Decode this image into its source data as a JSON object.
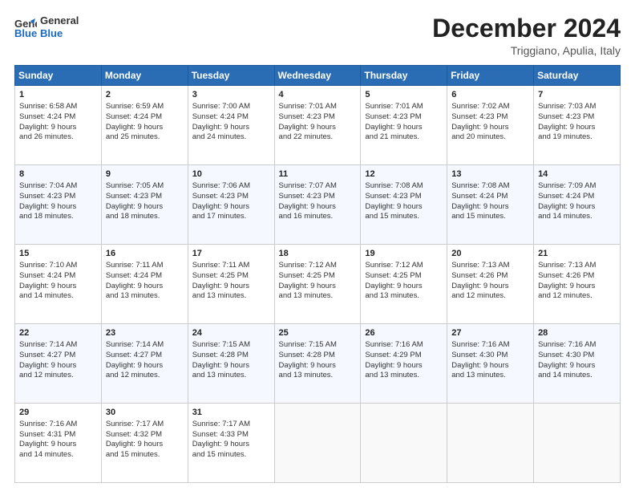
{
  "logo": {
    "line1": "General",
    "line2": "Blue"
  },
  "title": "December 2024",
  "location": "Triggiano, Apulia, Italy",
  "weekdays": [
    "Sunday",
    "Monday",
    "Tuesday",
    "Wednesday",
    "Thursday",
    "Friday",
    "Saturday"
  ],
  "weeks": [
    [
      {
        "day": "1",
        "lines": [
          "Sunrise: 6:58 AM",
          "Sunset: 4:24 PM",
          "Daylight: 9 hours",
          "and 26 minutes."
        ]
      },
      {
        "day": "2",
        "lines": [
          "Sunrise: 6:59 AM",
          "Sunset: 4:24 PM",
          "Daylight: 9 hours",
          "and 25 minutes."
        ]
      },
      {
        "day": "3",
        "lines": [
          "Sunrise: 7:00 AM",
          "Sunset: 4:24 PM",
          "Daylight: 9 hours",
          "and 24 minutes."
        ]
      },
      {
        "day": "4",
        "lines": [
          "Sunrise: 7:01 AM",
          "Sunset: 4:23 PM",
          "Daylight: 9 hours",
          "and 22 minutes."
        ]
      },
      {
        "day": "5",
        "lines": [
          "Sunrise: 7:01 AM",
          "Sunset: 4:23 PM",
          "Daylight: 9 hours",
          "and 21 minutes."
        ]
      },
      {
        "day": "6",
        "lines": [
          "Sunrise: 7:02 AM",
          "Sunset: 4:23 PM",
          "Daylight: 9 hours",
          "and 20 minutes."
        ]
      },
      {
        "day": "7",
        "lines": [
          "Sunrise: 7:03 AM",
          "Sunset: 4:23 PM",
          "Daylight: 9 hours",
          "and 19 minutes."
        ]
      }
    ],
    [
      {
        "day": "8",
        "lines": [
          "Sunrise: 7:04 AM",
          "Sunset: 4:23 PM",
          "Daylight: 9 hours",
          "and 18 minutes."
        ]
      },
      {
        "day": "9",
        "lines": [
          "Sunrise: 7:05 AM",
          "Sunset: 4:23 PM",
          "Daylight: 9 hours",
          "and 18 minutes."
        ]
      },
      {
        "day": "10",
        "lines": [
          "Sunrise: 7:06 AM",
          "Sunset: 4:23 PM",
          "Daylight: 9 hours",
          "and 17 minutes."
        ]
      },
      {
        "day": "11",
        "lines": [
          "Sunrise: 7:07 AM",
          "Sunset: 4:23 PM",
          "Daylight: 9 hours",
          "and 16 minutes."
        ]
      },
      {
        "day": "12",
        "lines": [
          "Sunrise: 7:08 AM",
          "Sunset: 4:23 PM",
          "Daylight: 9 hours",
          "and 15 minutes."
        ]
      },
      {
        "day": "13",
        "lines": [
          "Sunrise: 7:08 AM",
          "Sunset: 4:24 PM",
          "Daylight: 9 hours",
          "and 15 minutes."
        ]
      },
      {
        "day": "14",
        "lines": [
          "Sunrise: 7:09 AM",
          "Sunset: 4:24 PM",
          "Daylight: 9 hours",
          "and 14 minutes."
        ]
      }
    ],
    [
      {
        "day": "15",
        "lines": [
          "Sunrise: 7:10 AM",
          "Sunset: 4:24 PM",
          "Daylight: 9 hours",
          "and 14 minutes."
        ]
      },
      {
        "day": "16",
        "lines": [
          "Sunrise: 7:11 AM",
          "Sunset: 4:24 PM",
          "Daylight: 9 hours",
          "and 13 minutes."
        ]
      },
      {
        "day": "17",
        "lines": [
          "Sunrise: 7:11 AM",
          "Sunset: 4:25 PM",
          "Daylight: 9 hours",
          "and 13 minutes."
        ]
      },
      {
        "day": "18",
        "lines": [
          "Sunrise: 7:12 AM",
          "Sunset: 4:25 PM",
          "Daylight: 9 hours",
          "and 13 minutes."
        ]
      },
      {
        "day": "19",
        "lines": [
          "Sunrise: 7:12 AM",
          "Sunset: 4:25 PM",
          "Daylight: 9 hours",
          "and 13 minutes."
        ]
      },
      {
        "day": "20",
        "lines": [
          "Sunrise: 7:13 AM",
          "Sunset: 4:26 PM",
          "Daylight: 9 hours",
          "and 12 minutes."
        ]
      },
      {
        "day": "21",
        "lines": [
          "Sunrise: 7:13 AM",
          "Sunset: 4:26 PM",
          "Daylight: 9 hours",
          "and 12 minutes."
        ]
      }
    ],
    [
      {
        "day": "22",
        "lines": [
          "Sunrise: 7:14 AM",
          "Sunset: 4:27 PM",
          "Daylight: 9 hours",
          "and 12 minutes."
        ]
      },
      {
        "day": "23",
        "lines": [
          "Sunrise: 7:14 AM",
          "Sunset: 4:27 PM",
          "Daylight: 9 hours",
          "and 12 minutes."
        ]
      },
      {
        "day": "24",
        "lines": [
          "Sunrise: 7:15 AM",
          "Sunset: 4:28 PM",
          "Daylight: 9 hours",
          "and 13 minutes."
        ]
      },
      {
        "day": "25",
        "lines": [
          "Sunrise: 7:15 AM",
          "Sunset: 4:28 PM",
          "Daylight: 9 hours",
          "and 13 minutes."
        ]
      },
      {
        "day": "26",
        "lines": [
          "Sunrise: 7:16 AM",
          "Sunset: 4:29 PM",
          "Daylight: 9 hours",
          "and 13 minutes."
        ]
      },
      {
        "day": "27",
        "lines": [
          "Sunrise: 7:16 AM",
          "Sunset: 4:30 PM",
          "Daylight: 9 hours",
          "and 13 minutes."
        ]
      },
      {
        "day": "28",
        "lines": [
          "Sunrise: 7:16 AM",
          "Sunset: 4:30 PM",
          "Daylight: 9 hours",
          "and 14 minutes."
        ]
      }
    ],
    [
      {
        "day": "29",
        "lines": [
          "Sunrise: 7:16 AM",
          "Sunset: 4:31 PM",
          "Daylight: 9 hours",
          "and 14 minutes."
        ]
      },
      {
        "day": "30",
        "lines": [
          "Sunrise: 7:17 AM",
          "Sunset: 4:32 PM",
          "Daylight: 9 hours",
          "and 15 minutes."
        ]
      },
      {
        "day": "31",
        "lines": [
          "Sunrise: 7:17 AM",
          "Sunset: 4:33 PM",
          "Daylight: 9 hours",
          "and 15 minutes."
        ]
      },
      null,
      null,
      null,
      null
    ]
  ]
}
